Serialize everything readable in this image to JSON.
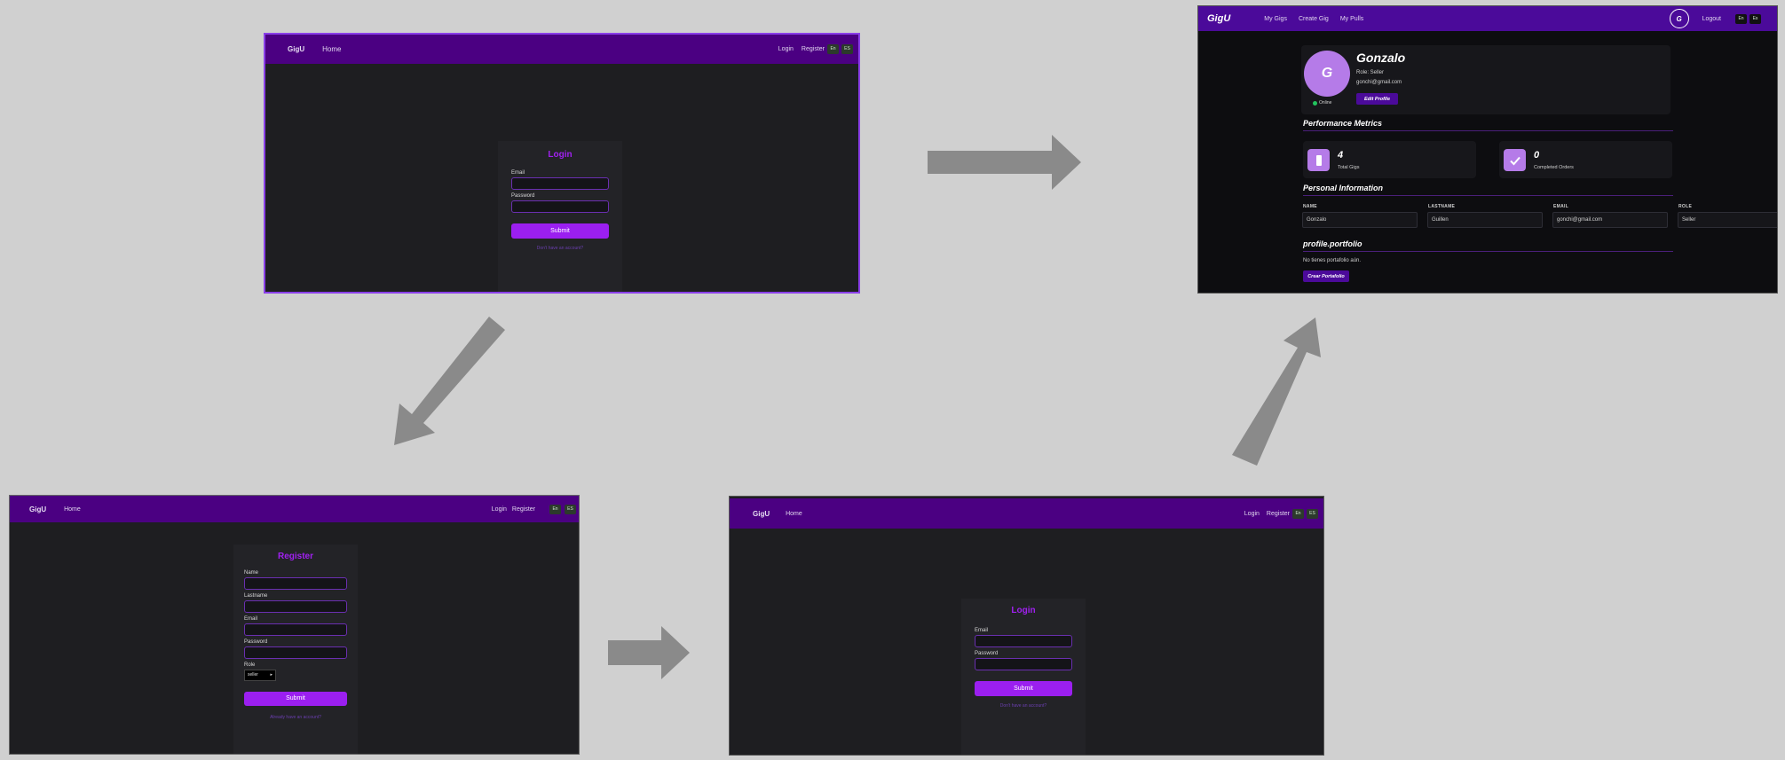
{
  "app": {
    "brand": "GigU"
  },
  "login_page": {
    "nav": {
      "brand": "GigU",
      "home": "Home",
      "login": "Login",
      "register": "Register",
      "lang_en": "En",
      "lang_es": "ES"
    },
    "title": "Login",
    "email_label": "Email",
    "password_label": "Password",
    "submit": "Submit",
    "account_link": "Don't have an account?"
  },
  "register_page": {
    "nav": {
      "brand": "GigU",
      "home": "Home",
      "login": "Login",
      "register": "Register",
      "lang_en": "En",
      "lang_es": "ES"
    },
    "title": "Register",
    "name_label": "Name",
    "lastname_label": "Lastname",
    "email_label": "Email",
    "password_label": "Password",
    "role_label": "Role",
    "role_value": "seller",
    "submit": "Submit",
    "account_link": "Already have an account?"
  },
  "profile_page": {
    "nav": {
      "brand": "GigU",
      "my_gigs": "My Gigs",
      "create_gig": "Create Gig",
      "my_pulls": "My Pulls",
      "avatar_letter": "G",
      "logout": "Logout",
      "lang_en": "En",
      "lang_es": "Es"
    },
    "avatar_letter": "G",
    "name": "Gonzalo",
    "role": "Role: Seller",
    "email": "gonchi@gmail.com",
    "status": "Online",
    "edit_button": "Edit Profile",
    "metrics_title": "Performance Metrics",
    "metrics": [
      {
        "value": "4",
        "label": "Total Gigs"
      },
      {
        "value": "0",
        "label": "Completed Orders"
      }
    ],
    "personal_title": "Personal Information",
    "fields": [
      {
        "label": "NAME",
        "value": "Gonzalo"
      },
      {
        "label": "LASTNAME",
        "value": "Guillen"
      },
      {
        "label": "EMAIL",
        "value": "gonchi@gmail.com"
      },
      {
        "label": "ROLE",
        "value": "Seller"
      }
    ],
    "portfolio_title": "profile.portfolio",
    "portfolio_empty": "No tienes portafolio aún.",
    "portfolio_button": "Crear Portafolio"
  },
  "colors": {
    "nav": "#4b0082",
    "accent": "#9b1ff0",
    "background": "#d0d0d0",
    "online": "#22c55e"
  }
}
